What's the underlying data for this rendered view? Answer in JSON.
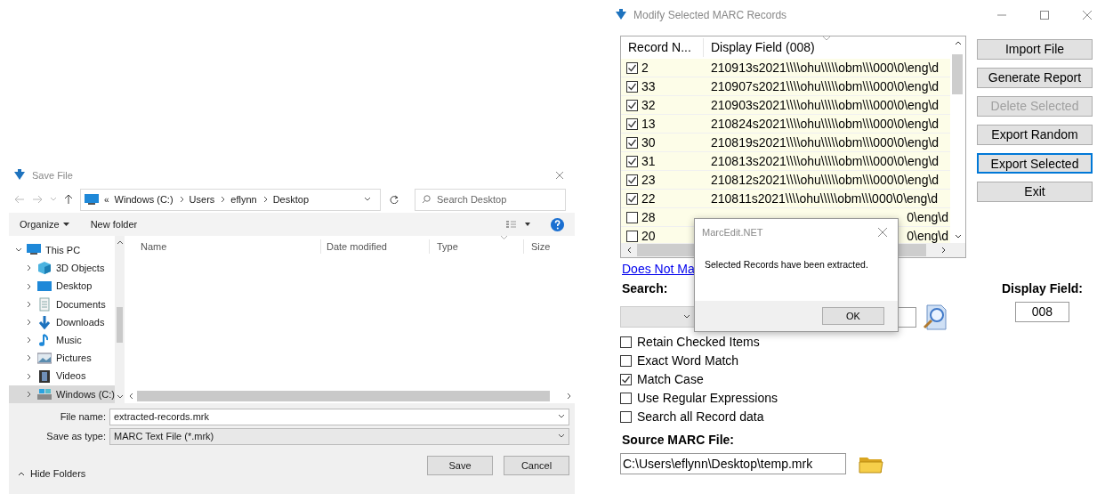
{
  "save_dialog": {
    "title": "Save File",
    "path": [
      "Windows (C:)",
      "Users",
      "eflynn",
      "Desktop"
    ],
    "path_prefix": "«",
    "search": {
      "placeholder": "Search Desktop"
    },
    "toolbar": {
      "organize": "Organize",
      "new_folder": "New folder"
    },
    "nav_items": [
      {
        "kind": "pc",
        "label": "This PC",
        "expanded": true,
        "selected": false,
        "children": [
          {
            "kind": "cube",
            "label": "3D Objects",
            "expanded": false,
            "selected": false
          },
          {
            "kind": "desktop",
            "label": "Desktop",
            "expanded": false,
            "selected": false
          },
          {
            "kind": "documents",
            "label": "Documents",
            "expanded": false,
            "selected": false
          },
          {
            "kind": "downloads",
            "label": "Downloads",
            "expanded": false,
            "selected": false
          },
          {
            "kind": "music",
            "label": "Music",
            "expanded": false,
            "selected": false
          },
          {
            "kind": "pictures",
            "label": "Pictures",
            "expanded": false,
            "selected": false
          },
          {
            "kind": "videos",
            "label": "Videos",
            "expanded": false,
            "selected": false
          },
          {
            "kind": "drive",
            "label": "Windows (C:)",
            "expanded": false,
            "selected": true
          }
        ]
      }
    ],
    "columns": [
      "Name",
      "Date modified",
      "Type",
      "Size"
    ],
    "file_name_label": "File name:",
    "file_name": "extracted-records.mrk",
    "save_type_label": "Save as type:",
    "save_type": "MARC Text File (*.mrk)",
    "hide_folders": "Hide Folders",
    "buttons": [
      "Save",
      "Cancel"
    ]
  },
  "main_window": {
    "title": "Modify Selected MARC Records",
    "columns": [
      "Record N...",
      "Display Field (008)"
    ],
    "rows": [
      {
        "checked": true,
        "number": "2",
        "field": "210913s2021\\\\\\\\ohu\\\\\\\\\\obm\\\\\\000\\0\\eng\\d"
      },
      {
        "checked": true,
        "number": "33",
        "field": "210907s2021\\\\\\\\ohu\\\\\\\\\\obm\\\\\\000\\0\\eng\\d"
      },
      {
        "checked": true,
        "number": "32",
        "field": "210903s2021\\\\\\\\ohu\\\\\\\\\\obm\\\\\\000\\0\\eng\\d"
      },
      {
        "checked": true,
        "number": "13",
        "field": "210824s2021\\\\\\\\ohu\\\\\\\\\\obm\\\\\\000\\0\\eng\\d"
      },
      {
        "checked": true,
        "number": "30",
        "field": "210819s2021\\\\\\\\ohu\\\\\\\\\\obm\\\\\\000\\0\\eng\\d"
      },
      {
        "checked": true,
        "number": "31",
        "field": "210813s2021\\\\\\\\ohu\\\\\\\\\\obm\\\\\\000\\0\\eng\\d"
      },
      {
        "checked": true,
        "number": "23",
        "field": "210812s2021\\\\\\\\ohu\\\\\\\\\\obm\\\\\\000\\0\\eng\\d"
      },
      {
        "checked": true,
        "number": "22",
        "field": "210811s2021\\\\\\\\ohu\\\\\\\\\\obm\\\\\\000\\0\\eng\\d"
      },
      {
        "checked": false,
        "number": "28",
        "field": "0\\eng\\d",
        "kind": "clipped"
      },
      {
        "checked": false,
        "number": "20",
        "field": "0\\eng\\d",
        "kind": "clipped"
      }
    ],
    "buttons": [
      {
        "label": "Import File",
        "disabled": false,
        "focused": false
      },
      {
        "label": "Generate Report",
        "disabled": false,
        "focused": false
      },
      {
        "label": "Delete Selected",
        "disabled": true,
        "focused": false
      },
      {
        "label": "Export Random",
        "disabled": false,
        "focused": false
      },
      {
        "label": "Export Selected",
        "disabled": false,
        "focused": true
      },
      {
        "label": "Exit",
        "disabled": false,
        "focused": false
      }
    ],
    "link": "Does Not Ma",
    "search_label": "Search:",
    "display_field_label": "Display Field:",
    "display_field": "008",
    "options": [
      {
        "label": "Retain Checked Items",
        "checked": false
      },
      {
        "label": "Exact Word Match",
        "checked": false
      },
      {
        "label": "Match Case",
        "checked": true
      },
      {
        "label": "Use Regular Expressions",
        "checked": false
      },
      {
        "label": "Search all Record data",
        "checked": false
      }
    ],
    "source_label": "Source MARC File:",
    "source_file": "C:\\Users\\eflynn\\Desktop\\temp.mrk"
  },
  "message_box": {
    "title": "MarcEdit.NET",
    "message": "Selected Records have been extracted.",
    "button": "OK"
  }
}
